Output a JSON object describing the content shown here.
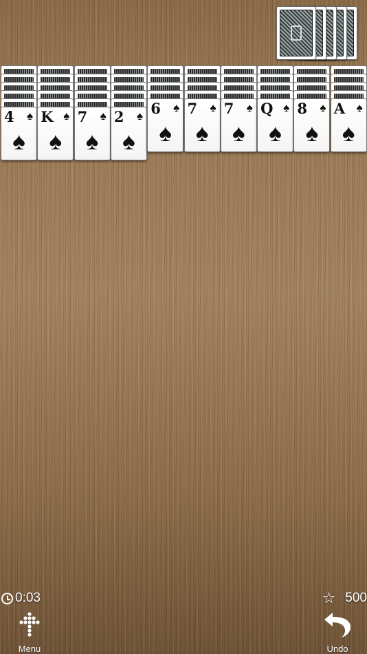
{
  "stock": {
    "piles": 5
  },
  "tableau": {
    "columns": [
      {
        "facedown": 5,
        "rank": "4",
        "suit": "♠"
      },
      {
        "facedown": 5,
        "rank": "K",
        "suit": "♠"
      },
      {
        "facedown": 5,
        "rank": "7",
        "suit": "♠"
      },
      {
        "facedown": 5,
        "rank": "2",
        "suit": "♠"
      },
      {
        "facedown": 4,
        "rank": "6",
        "suit": "♠"
      },
      {
        "facedown": 4,
        "rank": "7",
        "suit": "♠"
      },
      {
        "facedown": 4,
        "rank": "7",
        "suit": "♠"
      },
      {
        "facedown": 4,
        "rank": "Q",
        "suit": "♠"
      },
      {
        "facedown": 4,
        "rank": "8",
        "suit": "♠"
      },
      {
        "facedown": 4,
        "rank": "A",
        "suit": "♠"
      }
    ]
  },
  "hud": {
    "time": "0:03",
    "score": "500",
    "menu_label": "Menu",
    "undo_label": "Undo",
    "clock_icon": "clock-icon",
    "star_icon": "star-icon",
    "menu_icon": "menu-dots-icon",
    "undo_icon": "undo-arrow-icon"
  }
}
